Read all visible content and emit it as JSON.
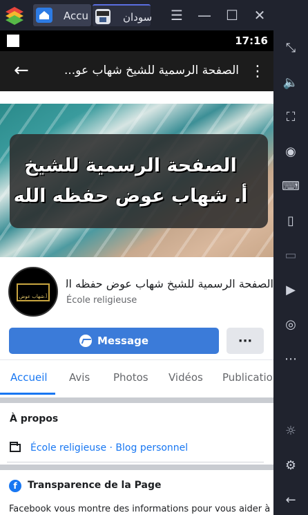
{
  "emulator": {
    "tabs": [
      {
        "label": "Accu",
        "icon": "home-app-icon"
      },
      {
        "label": "سودان",
        "icon": "app-thumbnail-icon"
      }
    ],
    "window_controls": {
      "menu": "☰",
      "minimize": "—",
      "maximize": "☐",
      "close": "✕",
      "collapse": "«"
    },
    "sidebar": [
      {
        "icon": "fullscreen-icon",
        "glyph": "⤡"
      },
      {
        "icon": "volume-icon",
        "glyph": "🔈"
      },
      {
        "icon": "screenshot-crop-icon",
        "glyph": "⛶"
      },
      {
        "icon": "eye-icon",
        "glyph": "◉"
      },
      {
        "icon": "keyboard-icon",
        "glyph": "⌨"
      },
      {
        "icon": "apk-install-icon",
        "glyph": "▯"
      },
      {
        "icon": "gamepad-icon",
        "glyph": "▭"
      },
      {
        "icon": "media-folder-icon",
        "glyph": "▶"
      },
      {
        "icon": "camera-icon",
        "glyph": "◎"
      },
      {
        "icon": "more-dots-icon",
        "glyph": "⋯"
      },
      {
        "icon": "bulb-icon",
        "glyph": "☼"
      },
      {
        "icon": "settings-icon",
        "glyph": "⚙"
      },
      {
        "icon": "back-icon",
        "glyph": "←"
      }
    ]
  },
  "status_bar": {
    "time": "17:16"
  },
  "app_bar": {
    "title": "الصفحة الرسمية للشيخ شهاب عو...",
    "back": "←",
    "menu": "⋮"
  },
  "cover": {
    "line1": "الصفحة الرسمية للشيخ",
    "line2": "أ. شهاب عوض حفظه الله"
  },
  "profile": {
    "avatar_text": "أ.شهاب عوض"
  },
  "page": {
    "name": "الصفحة الرسمية للشيخ شهاب عوض حفظه الله",
    "category": "École religieuse"
  },
  "actions": {
    "message_label": "Message",
    "more_label": "···"
  },
  "tabs": [
    "Accueil",
    "Avis",
    "Photos",
    "Vidéos",
    "Publications"
  ],
  "about": {
    "title": "À propos",
    "link": "École religieuse · Blog personnel"
  },
  "transparency": {
    "title": "Transparence de la Page",
    "text": "Facebook vous montre des informations pour vous aider à"
  },
  "colors": {
    "accent": "#1877f2",
    "message_button": "#3b7bd9",
    "emulator_bg": "#20232e"
  }
}
